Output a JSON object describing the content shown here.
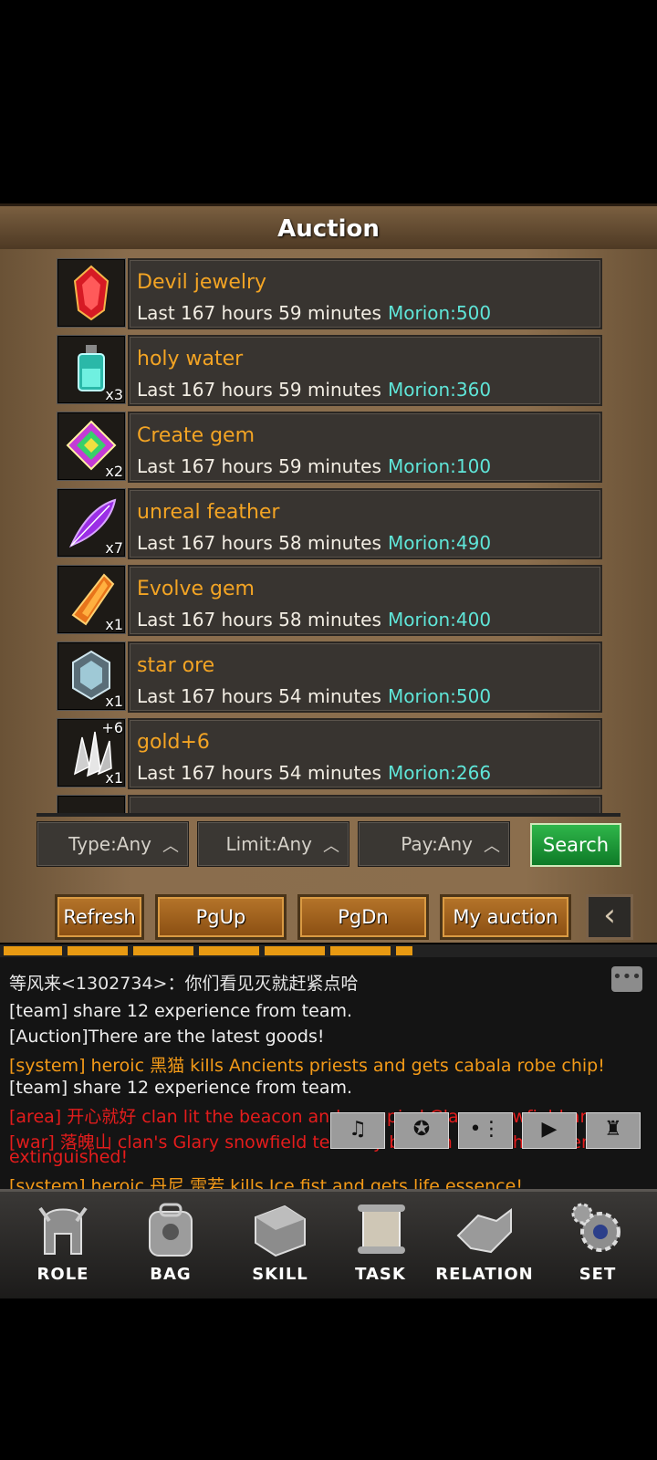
{
  "window": {
    "title": "Auction"
  },
  "items": [
    {
      "name": "Devil jewelry",
      "time": "Last 167 hours 59 minutes",
      "price": "Morion:500",
      "qty": "",
      "plus": "",
      "icon": "red-gem-icon",
      "color": "#e0202a"
    },
    {
      "name": "holy water",
      "time": "Last 167 hours 59 minutes",
      "price": "Morion:360",
      "qty": "x3",
      "plus": "",
      "icon": "potion-bottle-icon",
      "color": "#3fd6c8"
    },
    {
      "name": "Create gem",
      "time": "Last 167 hours 59 minutes",
      "price": "Morion:100",
      "qty": "x2",
      "plus": "",
      "icon": "rainbow-gem-icon",
      "color": "#c43bd6"
    },
    {
      "name": "unreal feather",
      "time": "Last 167 hours 58 minutes",
      "price": "Morion:490",
      "qty": "x7",
      "plus": "",
      "icon": "feather-icon",
      "color": "#9b2ee6"
    },
    {
      "name": "Evolve gem",
      "time": "Last 167 hours 58 minutes",
      "price": "Morion:400",
      "qty": "x1",
      "plus": "",
      "icon": "orange-crystal-icon",
      "color": "#e8741a"
    },
    {
      "name": "star ore",
      "time": "Last 167 hours 54 minutes",
      "price": "Morion:500",
      "qty": "x1",
      "plus": "",
      "icon": "ore-crystal-icon",
      "color": "#9fc9d6"
    },
    {
      "name": "gold+6",
      "time": "Last 167 hours 54 minutes",
      "price": "Morion:266",
      "qty": "x1",
      "plus": "+6",
      "icon": "silver-shards-icon",
      "color": "#d8d8d8"
    }
  ],
  "filters": {
    "type": "Type:Any",
    "limit": "Limit:Any",
    "pay": "Pay:Any",
    "search": "Search"
  },
  "buttons": {
    "refresh": "Refresh",
    "pgup": "PgUp",
    "pgdn": "PgDn",
    "my_auction": "My auction"
  },
  "chat": {
    "header": "等风来<1302734>：你们看见灭就赶紧点哈",
    "messages": [
      {
        "text": "[team] share 12 experience from team.",
        "color": "white"
      },
      {
        "text": "[Auction]There are the latest goods!",
        "color": "white"
      },
      {
        "text": "[system] heroic 黑猫 kills Ancients priests and gets cabala robe chip!",
        "color": "orange"
      },
      {
        "text": "[team] share 12 experience from team.",
        "color": "white"
      },
      {
        "text": "[area] 开心就好 clan lit the beacon and occupied Glary snowfield area.",
        "color": "red"
      },
      {
        "text": "[war] 落魄山 clan's Glary snowfield territory beacon tower has been",
        "color": "red"
      },
      {
        "text": "extinguished!",
        "color": "red"
      },
      {
        "text": "[system] heroic 丹尼 雷若 kills Ice fist and gets life essence!",
        "color": "orange"
      }
    ]
  },
  "nav": [
    {
      "label": "ROLE",
      "icon": "helmet-icon"
    },
    {
      "label": "BAG",
      "icon": "backpack-icon"
    },
    {
      "label": "SKILL",
      "icon": "skill-book-icon"
    },
    {
      "label": "TASK",
      "icon": "scroll-icon"
    },
    {
      "label": "RELATION",
      "icon": "handshake-icon"
    },
    {
      "label": "SET",
      "icon": "gears-icon"
    }
  ]
}
